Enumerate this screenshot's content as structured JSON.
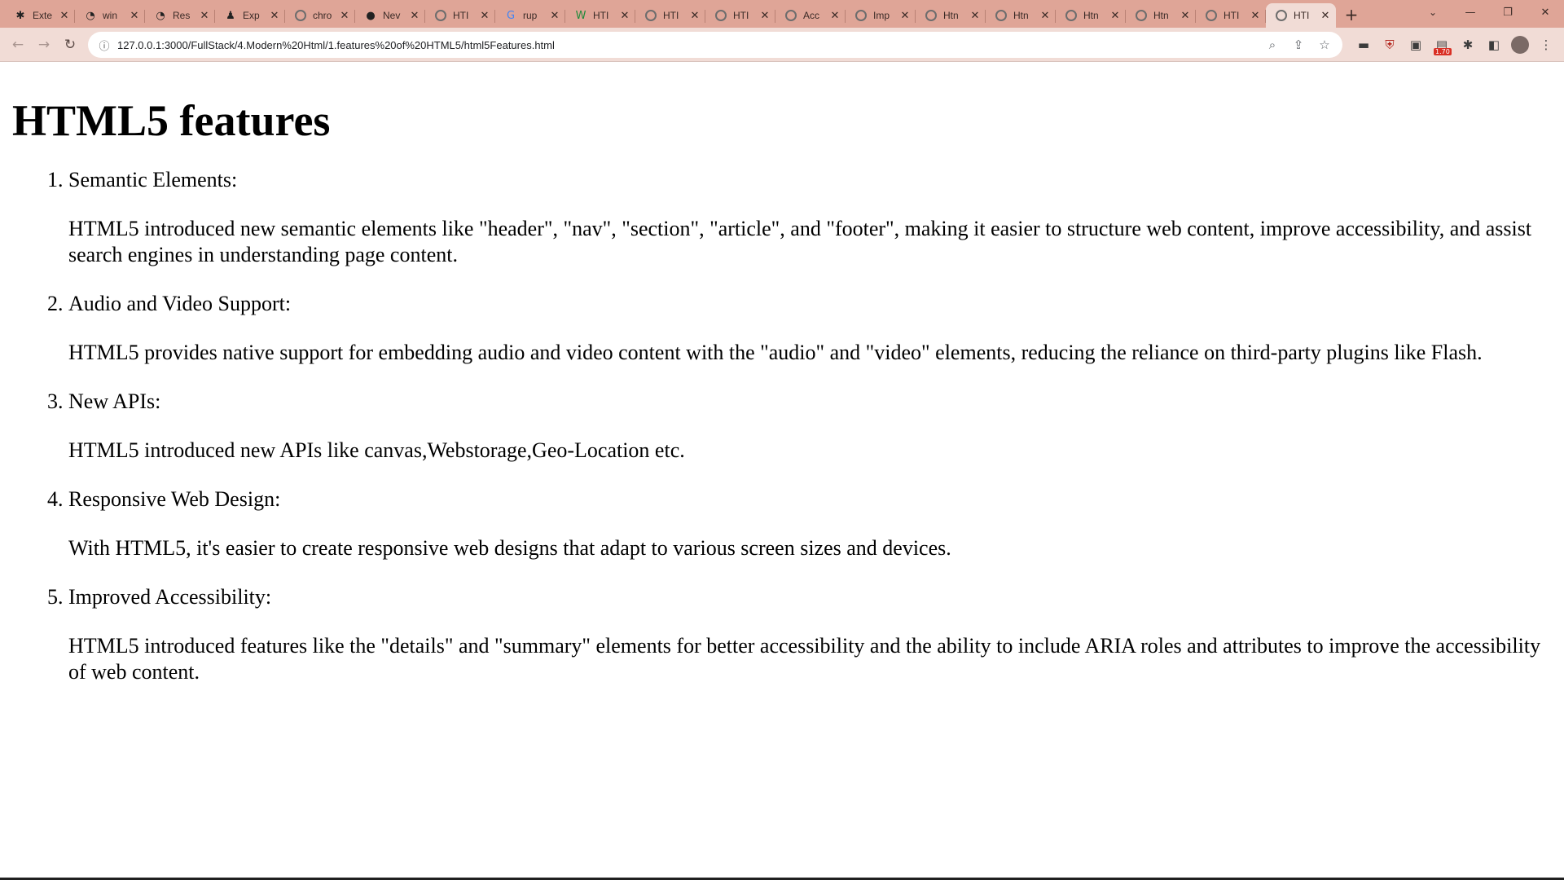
{
  "browser": {
    "tabs": [
      {
        "title": "Exte",
        "icon": "puzzle-icon"
      },
      {
        "title": "win",
        "icon": "site-icon"
      },
      {
        "title": "Res",
        "icon": "site-icon"
      },
      {
        "title": "Exp",
        "icon": "person-icon"
      },
      {
        "title": "chro",
        "icon": "globe-icon"
      },
      {
        "title": "Nev",
        "icon": "github-icon"
      },
      {
        "title": "HTI",
        "icon": "globe-icon"
      },
      {
        "title": "rup",
        "icon": "google-icon"
      },
      {
        "title": "HTI",
        "icon": "w-icon"
      },
      {
        "title": "HTI",
        "icon": "globe-icon"
      },
      {
        "title": "HTI",
        "icon": "globe-icon"
      },
      {
        "title": "Acc",
        "icon": "globe-icon"
      },
      {
        "title": "Imp",
        "icon": "globe-icon"
      },
      {
        "title": "Htn",
        "icon": "globe-icon"
      },
      {
        "title": "Htn",
        "icon": "globe-icon"
      },
      {
        "title": "Htn",
        "icon": "globe-icon"
      },
      {
        "title": "Htn",
        "icon": "globe-icon"
      },
      {
        "title": "HTI",
        "icon": "globe-icon"
      },
      {
        "title": "HTI",
        "icon": "globe-icon",
        "active": true
      }
    ],
    "url": "127.0.0.1:3000/FullStack/4.Modern%20Html/1.features%20of%20HTML5/html5Features.html",
    "extension_badge": "1.70"
  },
  "page": {
    "heading": "HTML5 features",
    "features": [
      {
        "title": "Semantic Elements:",
        "text": "HTML5 introduced new semantic elements like \"header\", \"nav\", \"section\", \"article\", and \"footer\", making it easier to structure web content, improve accessibility, and assist search engines in understanding page content."
      },
      {
        "title": "Audio and Video Support:",
        "text": "HTML5 provides native support for embedding audio and video content with the \"audio\" and \"video\" elements, reducing the reliance on third-party plugins like Flash."
      },
      {
        "title": "New APIs:",
        "text": "HTML5 introduced new APIs like canvas,Webstorage,Geo-Location etc."
      },
      {
        "title": "Responsive Web Design:",
        "text": "With HTML5, it's easier to create responsive web designs that adapt to various screen sizes and devices."
      },
      {
        "title": "Improved Accessibility:",
        "text": "HTML5 introduced features like the \"details\" and \"summary\" elements for better accessibility and the ability to include ARIA roles and attributes to improve the accessibility of web content."
      }
    ]
  },
  "colors": {
    "tabstrip": "#dfa597",
    "toolbar": "#f1dcd6"
  }
}
